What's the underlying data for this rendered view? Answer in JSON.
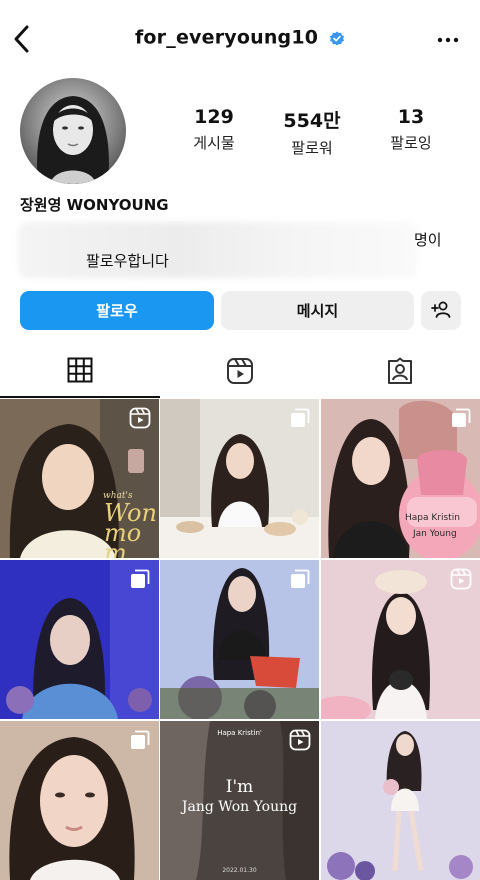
{
  "header": {
    "username": "for_everyoung10",
    "back_icon": "chevron-left-icon",
    "verified_icon": "verified-badge-icon",
    "more_icon": "more-horizontal-icon"
  },
  "profile": {
    "display_name": "장원영 WONYOUNG",
    "stats": [
      {
        "value": "129",
        "label": "게시물"
      },
      {
        "value": "554만",
        "label": "팔로워"
      },
      {
        "value": "13",
        "label": "팔로잉"
      }
    ],
    "followed_by_tail": "명이",
    "followed_by_text": "팔로우합니다"
  },
  "actions": {
    "follow_label": "팔로우",
    "message_label": "메시지",
    "add_user_icon": "add-person-icon"
  },
  "tabs": [
    {
      "icon": "grid-icon",
      "active": true
    },
    {
      "icon": "reels-icon",
      "active": false
    },
    {
      "icon": "tagged-icon",
      "active": false
    }
  ],
  "posts": [
    {
      "type": "reel",
      "caption": "Won mom",
      "small": "what's"
    },
    {
      "type": "multi"
    },
    {
      "type": "multi",
      "caption": "Hapa Kristin",
      "caption2": "Jan Young"
    },
    {
      "type": "multi"
    },
    {
      "type": "multi"
    },
    {
      "type": "reel"
    },
    {
      "type": "multi"
    },
    {
      "type": "reel",
      "brand": "Hapa Kristin'",
      "line1": "I'm",
      "line2": "Jang Won Young",
      "date": "2022.01.30"
    },
    {
      "type": "none"
    }
  ],
  "colors": {
    "follow_button": "#1a97f0",
    "secondary_button": "#efefef",
    "verified": "#3797f0"
  }
}
